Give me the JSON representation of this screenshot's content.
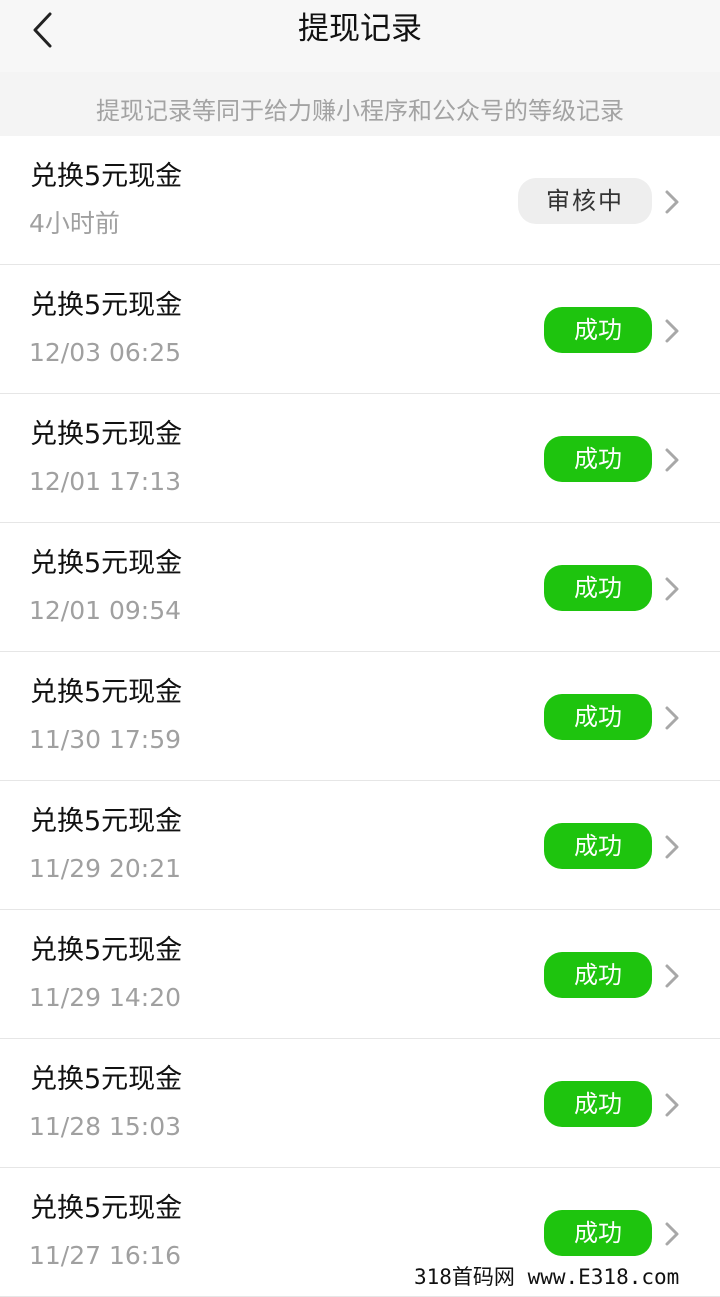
{
  "header": {
    "title": "提现记录",
    "back_icon": "chevron-left-icon"
  },
  "notice": {
    "text": "提现记录等同于给力赚小程序和公众号的等级记录"
  },
  "records": [
    {
      "title": "兑换5元现金",
      "time": "4小时前",
      "status": "审核中",
      "status_type": "pending"
    },
    {
      "title": "兑换5元现金",
      "time": "12/03 06:25",
      "status": "成功",
      "status_type": "success"
    },
    {
      "title": "兑换5元现金",
      "time": "12/01 17:13",
      "status": "成功",
      "status_type": "success"
    },
    {
      "title": "兑换5元现金",
      "time": "12/01 09:54",
      "status": "成功",
      "status_type": "success"
    },
    {
      "title": "兑换5元现金",
      "time": "11/30 17:59",
      "status": "成功",
      "status_type": "success"
    },
    {
      "title": "兑换5元现金",
      "time": "11/29 20:21",
      "status": "成功",
      "status_type": "success"
    },
    {
      "title": "兑换5元现金",
      "time": "11/29 14:20",
      "status": "成功",
      "status_type": "success"
    },
    {
      "title": "兑换5元现金",
      "time": "11/28 15:03",
      "status": "成功",
      "status_type": "success"
    },
    {
      "title": "兑换5元现金",
      "time": "11/27 16:16",
      "status": "成功",
      "status_type": "success"
    }
  ],
  "watermark": {
    "text": "318首码网 www.E318.com"
  },
  "colors": {
    "success": "#1ec40e",
    "pending_bg": "#eeeeee",
    "secondary_text": "#a0a0a0"
  }
}
